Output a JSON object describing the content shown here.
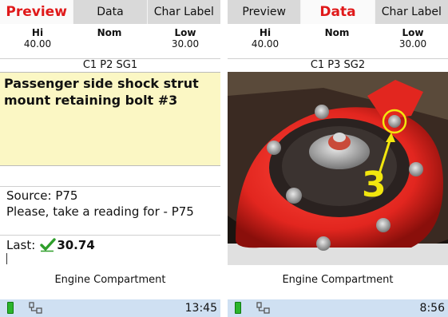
{
  "left_screen": {
    "tabs": {
      "preview": "Preview",
      "data": "Data",
      "char_label": "Char Label",
      "active": "preview"
    },
    "hi": {
      "label": "Hi",
      "value": "40.00"
    },
    "nom": {
      "label": "Nom"
    },
    "low": {
      "label": "Low",
      "value": "30.00"
    },
    "characteristic": "C1 P2 SG1",
    "description": "Passenger side shock strut mount retaining bolt #3",
    "source": "Source: P75",
    "prompt": "Please, take a reading for - P75",
    "last_label": "Last:",
    "last_value": "30.74",
    "location": "Engine Compartment",
    "time": "13:45",
    "colors": {
      "active_tab": "#e0191a",
      "description_bg": "#fbf7c4",
      "status_bar": "#cfe0f2",
      "battery": "#2bb52b"
    }
  },
  "right_screen": {
    "tabs": {
      "preview": "Preview",
      "data": "Data",
      "char_label": "Char Label",
      "active": "data"
    },
    "hi": {
      "label": "Hi",
      "value": "40.00"
    },
    "nom": {
      "label": "Nom"
    },
    "low": {
      "label": "Low",
      "value": "30.00"
    },
    "characteristic": "C1 P3 SG2",
    "photo_callout": "3",
    "location": "Engine Compartment",
    "time": "8:56",
    "colors": {
      "strut_mount": "#e2261f",
      "callout": "#f2e60e"
    }
  }
}
